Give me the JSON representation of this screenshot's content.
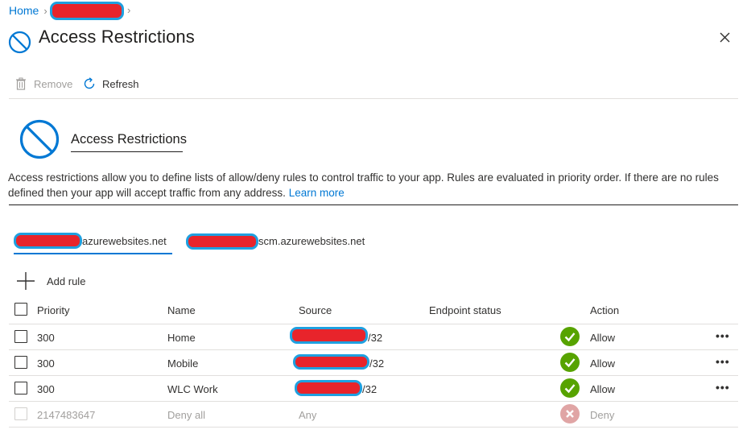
{
  "breadcrumb": {
    "home": "Home"
  },
  "header": {
    "title": "Access Restrictions"
  },
  "toolbar": {
    "remove_label": "Remove",
    "refresh_label": "Refresh"
  },
  "section": {
    "heading": "Access Restrictions",
    "description": "Access restrictions allow you to define lists of allow/deny rules to control traffic to your app. Rules are evaluated in priority order. If there are no rules defined then your app will accept traffic from any address.",
    "learn_more": "Learn more"
  },
  "tabs": [
    {
      "label": "azurewebsites.net",
      "active": true
    },
    {
      "label": "scm.azurewebsites.net",
      "active": false
    }
  ],
  "add_rule_label": "Add rule",
  "table": {
    "columns": [
      "Priority",
      "Name",
      "Source",
      "Endpoint status",
      "Action"
    ],
    "rows": [
      {
        "priority": "300",
        "name": "Home",
        "source_suffix": "/32",
        "action": "Allow",
        "status": "ok"
      },
      {
        "priority": "300",
        "name": "Mobile",
        "source_suffix": "/32",
        "action": "Allow",
        "status": "ok"
      },
      {
        "priority": "300",
        "name": "WLC Work",
        "source_suffix": "/32",
        "action": "Allow",
        "status": "ok"
      },
      {
        "priority": "2147483647",
        "name": "Deny all",
        "source": "Any",
        "action": "Deny",
        "status": "deny"
      }
    ],
    "more_label": "•••"
  },
  "colors": {
    "accent": "#0078d4",
    "success": "#57a300",
    "deny": "#e0a5a5"
  },
  "icons": [
    "block-icon",
    "close-icon",
    "trash-icon",
    "refresh-icon",
    "plus-icon",
    "check-icon",
    "x-icon",
    "more-icon"
  ]
}
